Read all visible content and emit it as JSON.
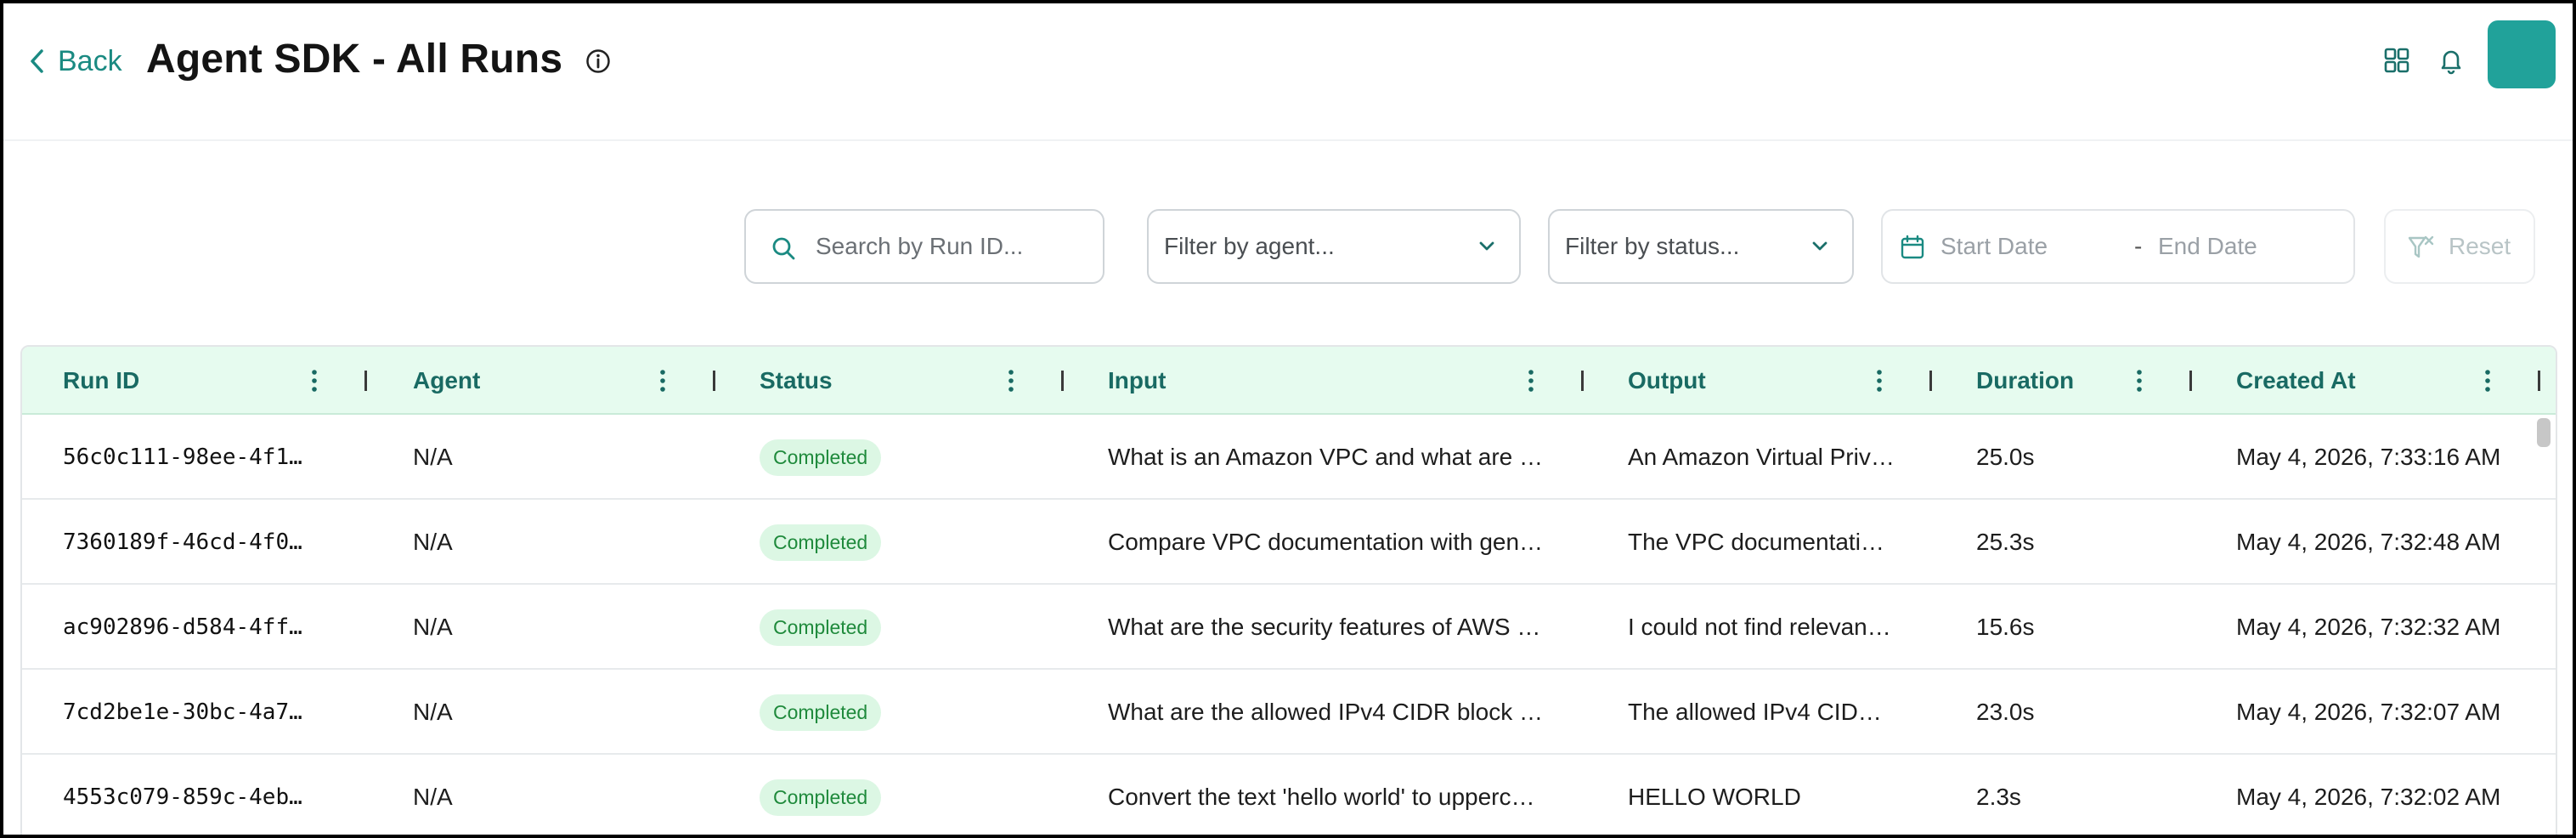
{
  "header": {
    "back_label": "Back",
    "title": "Agent SDK - All Runs",
    "icons": [
      "info-icon",
      "grid-icon",
      "bell-icon"
    ],
    "accent_color": "#1a8a82",
    "avatar_color": "#21a29a"
  },
  "filters": {
    "search_placeholder": "Search by Run ID...",
    "agent_placeholder": "Filter by agent...",
    "status_placeholder": "Filter by status...",
    "start_date_placeholder": "Start Date",
    "date_separator": "-",
    "end_date_placeholder": "End Date",
    "reset_label": "Reset"
  },
  "table": {
    "columns": [
      "Run ID",
      "Agent",
      "Status",
      "Input",
      "Output",
      "Duration",
      "Created At"
    ],
    "rows": [
      {
        "run_id": "56c0c111-98ee-4f1…",
        "agent": "N/A",
        "status": "Completed",
        "input": "What is an Amazon VPC and what are …",
        "output": "An Amazon Virtual Priv…",
        "duration": "25.0s",
        "created_at": "May 4, 2026, 7:33:16 AM"
      },
      {
        "run_id": "7360189f-46cd-4f0…",
        "agent": "N/A",
        "status": "Completed",
        "input": "Compare VPC documentation with gen…",
        "output": "The VPC documentati…",
        "duration": "25.3s",
        "created_at": "May 4, 2026, 7:32:48 AM"
      },
      {
        "run_id": "ac902896-d584-4ff…",
        "agent": "N/A",
        "status": "Completed",
        "input": "What are the security features of AWS …",
        "output": "I could not find relevan…",
        "duration": "15.6s",
        "created_at": "May 4, 2026, 7:32:32 AM"
      },
      {
        "run_id": "7cd2be1e-30bc-4a7…",
        "agent": "N/A",
        "status": "Completed",
        "input": "What are the allowed IPv4 CIDR block …",
        "output": "The allowed IPv4 CID…",
        "duration": "23.0s",
        "created_at": "May 4, 2026, 7:32:07 AM"
      },
      {
        "run_id": "4553c079-859c-4eb…",
        "agent": "N/A",
        "status": "Completed",
        "input": "Convert the text 'hello world' to upperc…",
        "output": "HELLO WORLD",
        "duration": "2.3s",
        "created_at": "May 4, 2026, 7:32:02 AM"
      }
    ]
  }
}
